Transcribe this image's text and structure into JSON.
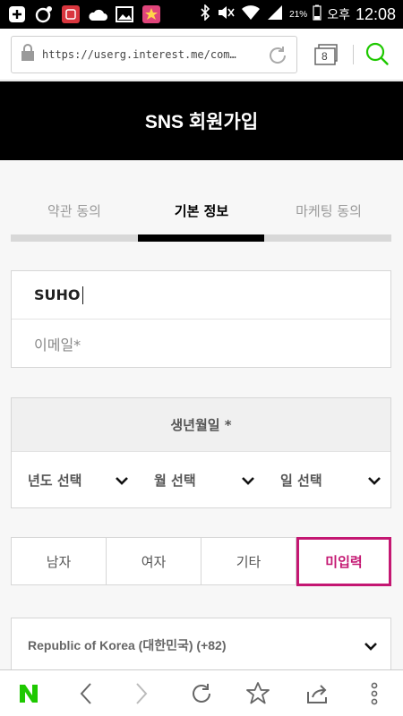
{
  "status_bar": {
    "battery_percent": "21%",
    "ampm": "오후",
    "time": "12:08",
    "notif_icons": [
      "add-icon",
      "camera-icon",
      "app-red-icon",
      "cloud-icon",
      "image-icon",
      "app-star-icon"
    ],
    "system_icons": [
      "bluetooth-icon",
      "mute-icon",
      "wifi-icon",
      "signal-icon"
    ]
  },
  "browser": {
    "url": "https://userg.interest.me/com…",
    "tab_count": "8"
  },
  "header": {
    "title": "SNS 회원가입"
  },
  "steps": [
    {
      "label": "약관 동의",
      "active": false
    },
    {
      "label": "기본 정보",
      "active": true
    },
    {
      "label": "마케팅 동의",
      "active": false
    }
  ],
  "form": {
    "name_value": "SUHO",
    "email_placeholder": "이메일*",
    "birthday": {
      "title": "생년월일 *",
      "year_label": "년도 선택",
      "month_label": "월 선택",
      "day_label": "일 선택"
    },
    "gender": [
      "남자",
      "여자",
      "기타",
      "미입력"
    ],
    "gender_selected": "미입력",
    "country": "Republic of Korea (대한민국) (+82)"
  },
  "colors": {
    "accent": "#c41772",
    "naver_green": "#1ec800",
    "header_bg": "#000000"
  }
}
